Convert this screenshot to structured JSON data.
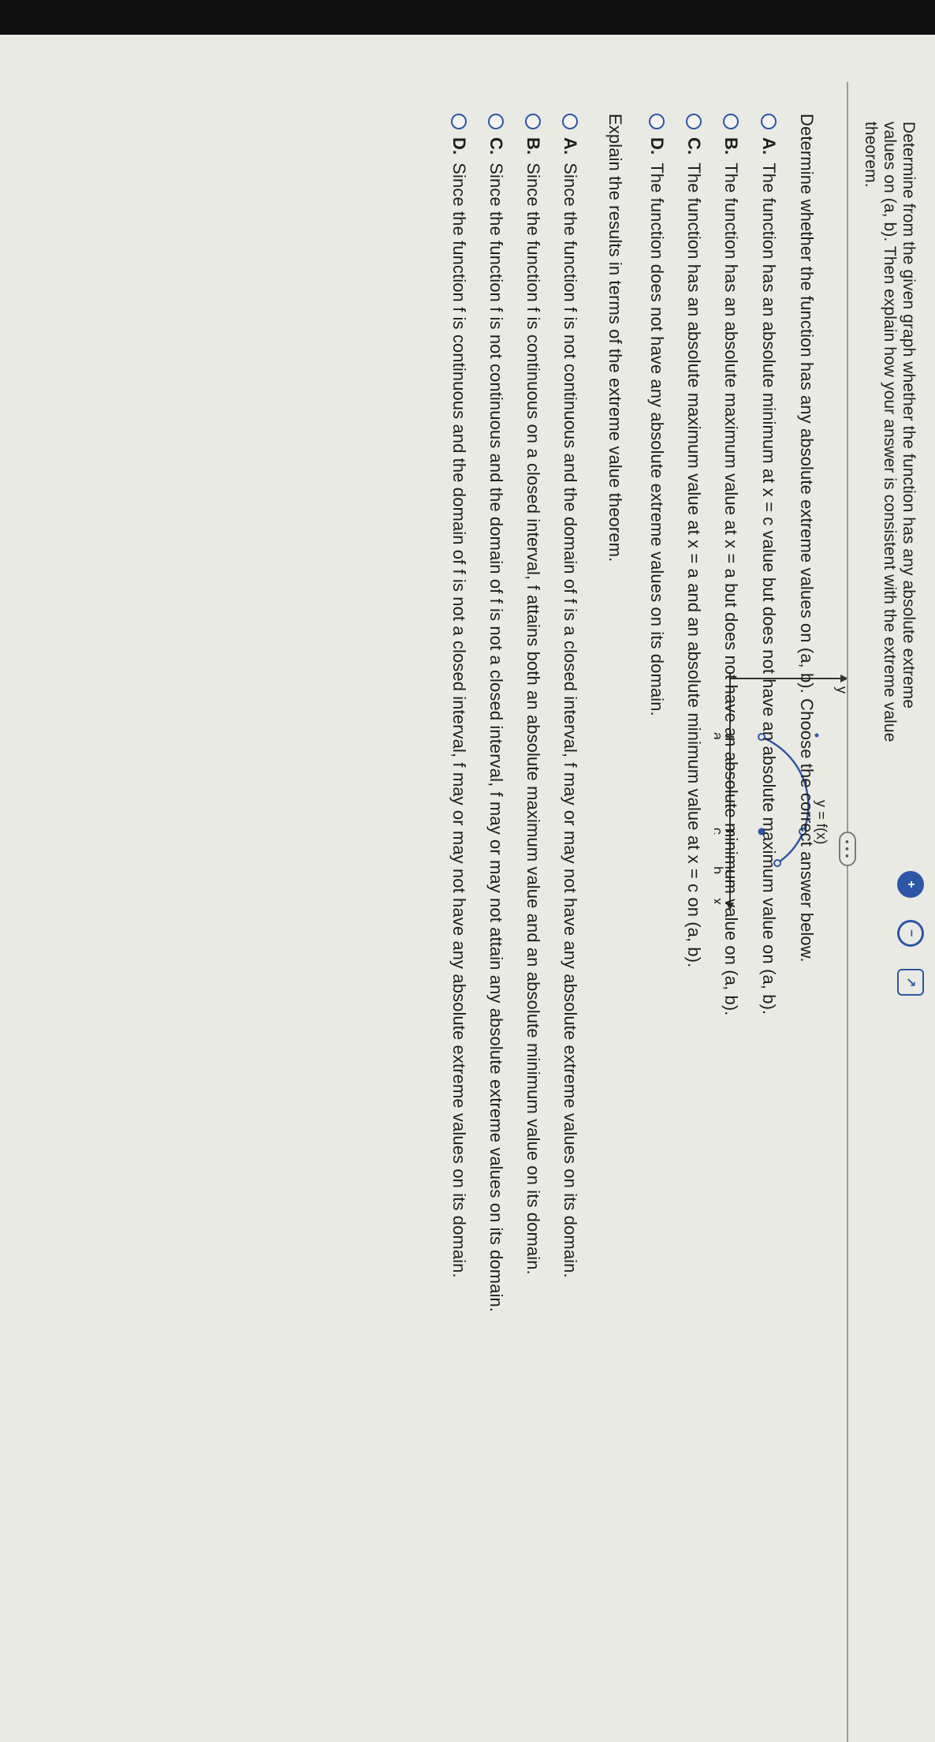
{
  "header": {
    "instructions": "Determine from the given graph whether the function has any absolute extreme values on (a, b). Then explain how your answer is consistent with the extreme value theorem."
  },
  "tools": {
    "zoom_in_icon": "zoom-in-icon",
    "zoom_out_icon": "zoom-out-icon",
    "popout_icon": "popout-icon"
  },
  "graph": {
    "y_label": "y",
    "x_label": "x",
    "func_label": "y = f(x)",
    "tick_a": "a",
    "tick_c": "c",
    "tick_b": "b"
  },
  "more_button": "• • •",
  "question1": {
    "prompt": "Determine whether the function has any absolute extreme values on (a, b). Choose the correct answer below.",
    "options": [
      {
        "letter": "A.",
        "text": "The function has an absolute minimum at x = c value but does not have an absolute maximum value on (a, b)."
      },
      {
        "letter": "B.",
        "text": "The function has an absolute maximum value at x = a but does not have an absolute minimum value on (a, b)."
      },
      {
        "letter": "C.",
        "text": "The function has an absolute maximum value at x = a and an absolute minimum value at x = c on (a, b)."
      },
      {
        "letter": "D.",
        "text": "The function does not have any absolute extreme values on its domain."
      }
    ]
  },
  "question2": {
    "prompt": "Explain the results in terms of the extreme value theorem.",
    "options": [
      {
        "letter": "A.",
        "text": "Since the function f is not continuous and the domain of f is a closed interval, f may or may not have any absolute extreme values on its domain."
      },
      {
        "letter": "B.",
        "text": "Since the function f is continuous on a closed interval, f attains both an absolute maximum value and an absolute minimum value on its domain."
      },
      {
        "letter": "C.",
        "text": "Since the function f is not continuous and the domain of f is not a closed interval, f may or may not attain any absolute extreme values on its domain."
      },
      {
        "letter": "D.",
        "text": "Since the function f is continuous and the domain of f is not a closed interval, f may or may not have any absolute extreme values on its domain."
      }
    ]
  }
}
